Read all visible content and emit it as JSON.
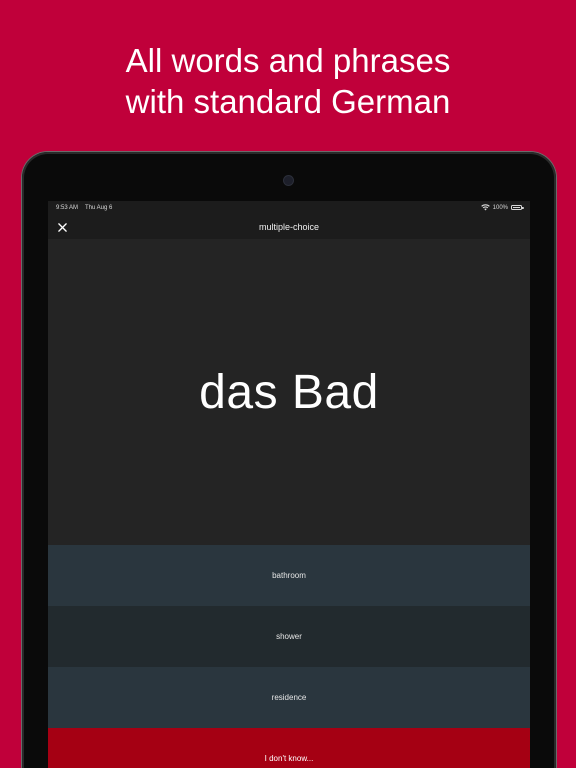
{
  "headline": {
    "line1": "All words and phrases",
    "line2": "with standard German"
  },
  "statusbar": {
    "time": "9:53 AM",
    "date": "Thu Aug 6",
    "battery": "100%"
  },
  "navbar": {
    "close_icon": "close-icon",
    "title": "multiple-choice"
  },
  "question": {
    "word": "das Bad"
  },
  "options": [
    {
      "label": "bathroom"
    },
    {
      "label": "shower"
    },
    {
      "label": "residence"
    }
  ],
  "dont_know": {
    "label": "I don't know..."
  },
  "colors": {
    "background": "#c0003a",
    "screen": "#242424",
    "option_dark": "#2a363e",
    "option_alt": "#222a2e",
    "dont_know": "#a50013"
  }
}
